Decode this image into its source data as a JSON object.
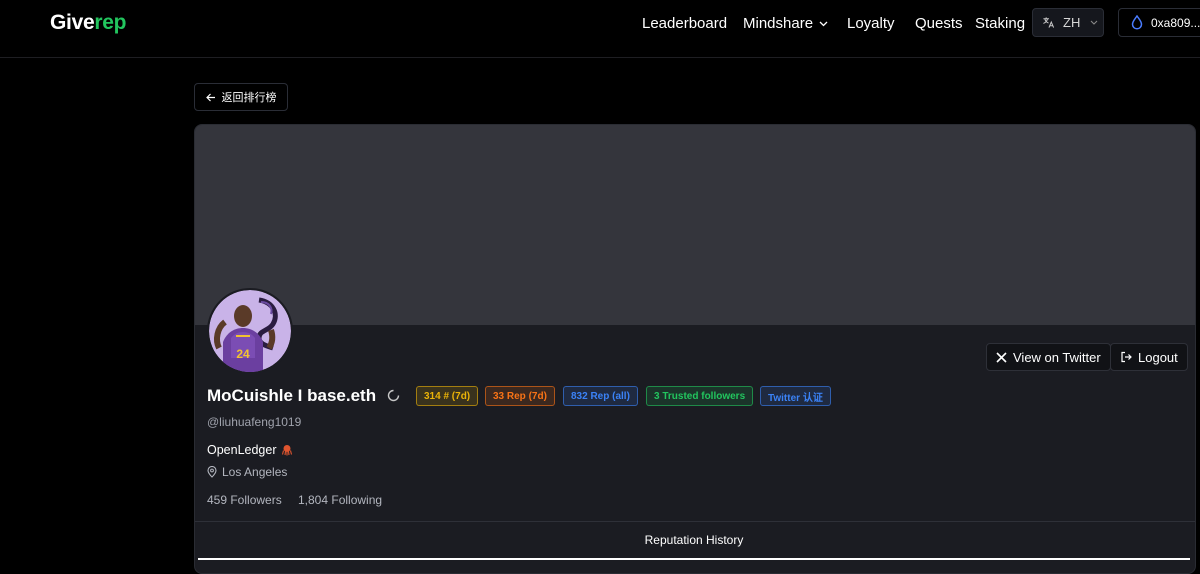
{
  "header": {
    "logo_part1": "Give",
    "logo_part2": "rep",
    "nav": [
      "Leaderboard",
      "Mindshare",
      "Loyalty",
      "Quests",
      "Staking"
    ],
    "language": "ZH",
    "wallet": "0xa809..."
  },
  "back_button": "返回排行榜",
  "profile": {
    "view_twitter": "View on Twitter",
    "logout": "Logout",
    "name": "MoCuishle I base.eth",
    "badges": [
      {
        "text": "314 # (7d)",
        "color": "#eab308"
      },
      {
        "text": "33 Rep (7d)",
        "color": "#f97316"
      },
      {
        "text": "832 Rep (all)",
        "color": "#3b82f6"
      },
      {
        "text": "3 Trusted followers",
        "color": "#22c55e"
      },
      {
        "text": "Twitter 认证",
        "color": "#3b82f6"
      }
    ],
    "handle": "@liuhuafeng1019",
    "bio": "OpenLedger",
    "location": "Los Angeles",
    "followers": "459 Followers",
    "following": "1,804 Following",
    "avatar_jersey_number": "24"
  },
  "tabs": [
    "Reputation History"
  ]
}
